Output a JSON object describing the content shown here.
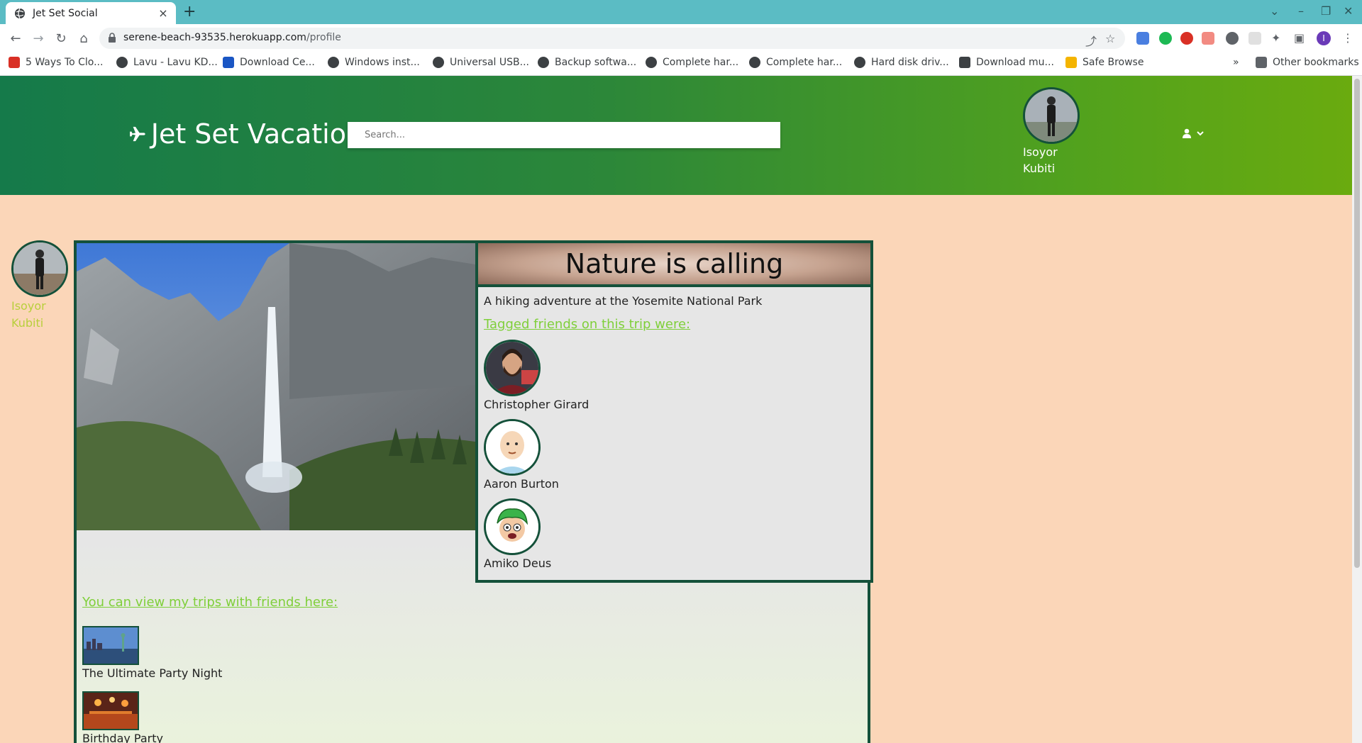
{
  "browser": {
    "tab_title": "Jet Set Social",
    "tab_close": "×",
    "new_tab": "+",
    "url_host": "serene-beach-93535.herokuapp.com",
    "url_path": "/profile",
    "bookmarks": [
      {
        "label": "5 Ways To Clo...",
        "color": "#d93025"
      },
      {
        "label": "Lavu - Lavu KD...",
        "color": "#3c4043"
      },
      {
        "label": "Download Ce...",
        "color": "#1a56c4"
      },
      {
        "label": "Windows inst...",
        "color": "#3c4043"
      },
      {
        "label": "Universal USB...",
        "color": "#3c4043"
      },
      {
        "label": "Backup softwa...",
        "color": "#3c4043"
      },
      {
        "label": "Complete har...",
        "color": "#3c4043"
      },
      {
        "label": "Complete har...",
        "color": "#3c4043"
      },
      {
        "label": "Hard disk driv...",
        "color": "#3c4043"
      },
      {
        "label": "Download mu...",
        "color": "#3c4043"
      },
      {
        "label": "Safe Browse",
        "color": "#f4b400"
      }
    ],
    "overflow": "»",
    "other_bookmarks": "Other bookmarks",
    "profile_initial": "I"
  },
  "site": {
    "name": "Jet Set Vacatio",
    "search_placeholder": "Search...",
    "user_name_line1": "Isoyor",
    "user_name_line2": "Kubiti"
  },
  "profile": {
    "name_line1": "Isoyor",
    "name_line2": "Kubiti"
  },
  "trip": {
    "title": "Nature is calling",
    "description": "A hiking adventure at the Yosemite National Park",
    "tagged_label": "Tagged friends on this trip were:",
    "friends": [
      {
        "name": "Christopher Girard"
      },
      {
        "name": "Aaron Burton"
      },
      {
        "name": "Amiko Deus"
      }
    ]
  },
  "trips_section": {
    "link_label": "You can view my trips with friends here:",
    "trips": [
      {
        "name": "The Ultimate Party Night"
      },
      {
        "name": "Birthday Party"
      }
    ]
  },
  "colors": {
    "header_start": "#157a4a",
    "header_end": "#6aab0f",
    "page_bg": "#fbd6b8",
    "border": "#14513a",
    "link": "#7fcf3a"
  }
}
